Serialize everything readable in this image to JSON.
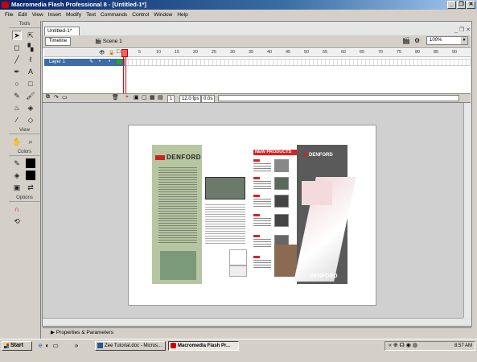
{
  "window": {
    "title": "Macromedia Flash Professional 8 - [Untitled-1*]",
    "controls": [
      "_",
      "❐",
      "✕"
    ]
  },
  "menu": [
    "File",
    "Edit",
    "View",
    "Insert",
    "Modify",
    "Text",
    "Commands",
    "Control",
    "Window",
    "Help"
  ],
  "tools": {
    "header": "Tools",
    "view_header": "View",
    "colors_header": "Colors",
    "options_header": "Options"
  },
  "document": {
    "tab": "Untitled-1*",
    "timeline_button": "Timeline",
    "scene": "Scene 1",
    "zoom": "100%"
  },
  "timeline": {
    "frame_numbers": [
      "5",
      "10",
      "15",
      "20",
      "25",
      "30",
      "35",
      "40",
      "45",
      "50",
      "55",
      "60",
      "65",
      "70",
      "75",
      "80",
      "85",
      "90"
    ],
    "layer_name": "Layer 1",
    "current_frame": "1",
    "fps": "12.0 fps",
    "time": "0.0s"
  },
  "magazine": {
    "brand_left": "DENFORD",
    "section_title": "NEW PRODUCTS",
    "brand_right": "DENFORD"
  },
  "properties_label": "Properties & Parameters",
  "taskbar": {
    "start": "Start",
    "tasks": [
      "Zee Tutorial.doc - Micros...",
      "Macromedia Flash Pr..."
    ],
    "clock": "8:57 AM"
  }
}
